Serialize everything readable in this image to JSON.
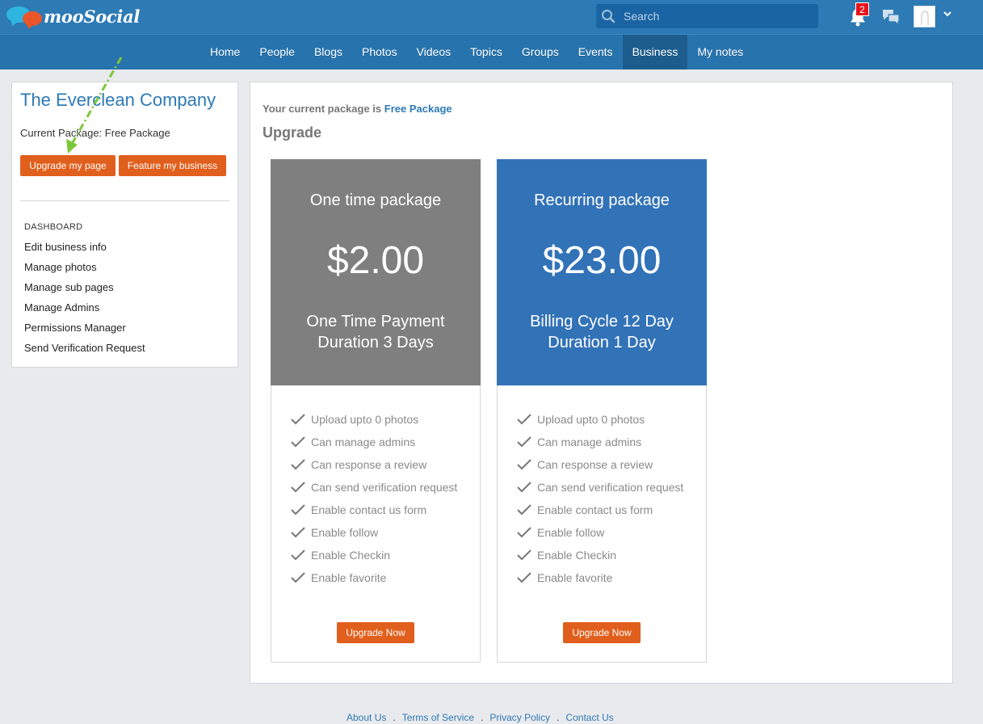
{
  "header": {
    "logo_text": "mooSocial",
    "search": {
      "placeholder": "Search",
      "value": ""
    },
    "notification_count": "2"
  },
  "nav": {
    "items": [
      {
        "label": "Home"
      },
      {
        "label": "People"
      },
      {
        "label": "Blogs"
      },
      {
        "label": "Photos"
      },
      {
        "label": "Videos"
      },
      {
        "label": "Topics"
      },
      {
        "label": "Groups"
      },
      {
        "label": "Events"
      },
      {
        "label": "Business"
      },
      {
        "label": "My notes"
      }
    ],
    "active": "Business"
  },
  "sidebar": {
    "business_name": "The Everclean Company",
    "current_package": "Current Package: Free Package",
    "upgrade_button": "Upgrade my page",
    "feature_button": "Feature my business",
    "section_title": "DASHBOARD",
    "menu": [
      "Edit business info",
      "Manage photos",
      "Manage sub pages",
      "Manage Admins",
      "Permissions Manager",
      "Send Verification Request"
    ]
  },
  "main": {
    "current_prefix": "Your current package is",
    "current_package": "Free Package",
    "heading": "Upgrade",
    "packages": [
      {
        "title": "One time package",
        "price": "$2.00",
        "line1": "One Time Payment",
        "line2": "Duration 3 Days",
        "color": "#7f7f7f",
        "features": [
          "Upload upto 0 photos",
          "Can manage admins",
          "Can response a review",
          "Can send verification request",
          "Enable contact us form",
          "Enable follow",
          "Enable Checkin",
          "Enable favorite"
        ],
        "button": "Upgrade Now"
      },
      {
        "title": "Recurring package",
        "price": "$23.00",
        "line1": "Billing Cycle 12 Day",
        "line2": "Duration 1 Day",
        "color": "#3272b7",
        "features": [
          "Upload upto 0 photos",
          "Can manage admins",
          "Can response a review",
          "Can send verification request",
          "Enable contact us form",
          "Enable follow",
          "Enable Checkin",
          "Enable favorite"
        ],
        "button": "Upgrade Now"
      }
    ]
  },
  "footer": {
    "links": [
      "About Us",
      "Terms of Service",
      "Privacy Policy",
      "Contact Us"
    ],
    "separator": "."
  },
  "colors": {
    "topbar": "#2d7ab5",
    "navbar": "#2773ad",
    "accent_orange": "#e15f1c",
    "link_blue": "#2d7ab5",
    "annotation_arrow": "#7dc83a"
  }
}
